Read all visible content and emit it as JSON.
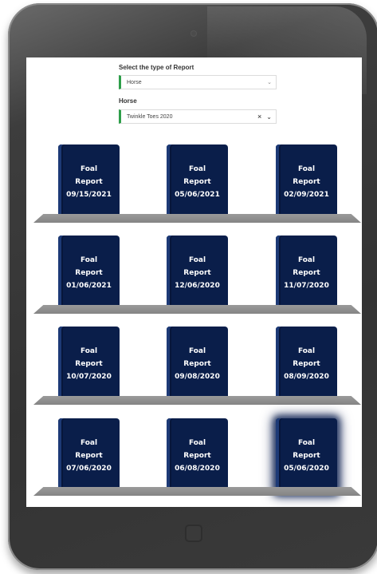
{
  "form": {
    "report_type_label": "Select the type of Report",
    "report_type_value": "Horse",
    "horse_label": "Horse",
    "horse_value": "Twinkle Toes 2020"
  },
  "icons": {
    "dropdown": "chevron-down-icon",
    "clear": "close-icon"
  },
  "colors": {
    "book": "#0a1e4a",
    "select_accent": "#2e9e4a",
    "shelf": "#8c8c8c"
  },
  "shelves": [
    {
      "books": [
        {
          "title": "Foal",
          "subtitle": "Report",
          "date": "09/15/2021"
        },
        {
          "title": "Foal",
          "subtitle": "Report",
          "date": "05/06/2021"
        },
        {
          "title": "Foal",
          "subtitle": "Report",
          "date": "02/09/2021"
        }
      ]
    },
    {
      "books": [
        {
          "title": "Foal",
          "subtitle": "Report",
          "date": "01/06/2021"
        },
        {
          "title": "Foal",
          "subtitle": "Report",
          "date": "12/06/2020"
        },
        {
          "title": "Foal",
          "subtitle": "Report",
          "date": "11/07/2020"
        }
      ]
    },
    {
      "books": [
        {
          "title": "Foal",
          "subtitle": "Report",
          "date": "10/07/2020"
        },
        {
          "title": "Foal",
          "subtitle": "Report",
          "date": "09/08/2020"
        },
        {
          "title": "Foal",
          "subtitle": "Report",
          "date": "08/09/2020"
        }
      ]
    },
    {
      "books": [
        {
          "title": "Foal",
          "subtitle": "Report",
          "date": "07/06/2020"
        },
        {
          "title": "Foal",
          "subtitle": "Report",
          "date": "06/08/2020"
        },
        {
          "title": "Foal",
          "subtitle": "Report",
          "date": "05/06/2020",
          "selected": true
        }
      ]
    }
  ]
}
